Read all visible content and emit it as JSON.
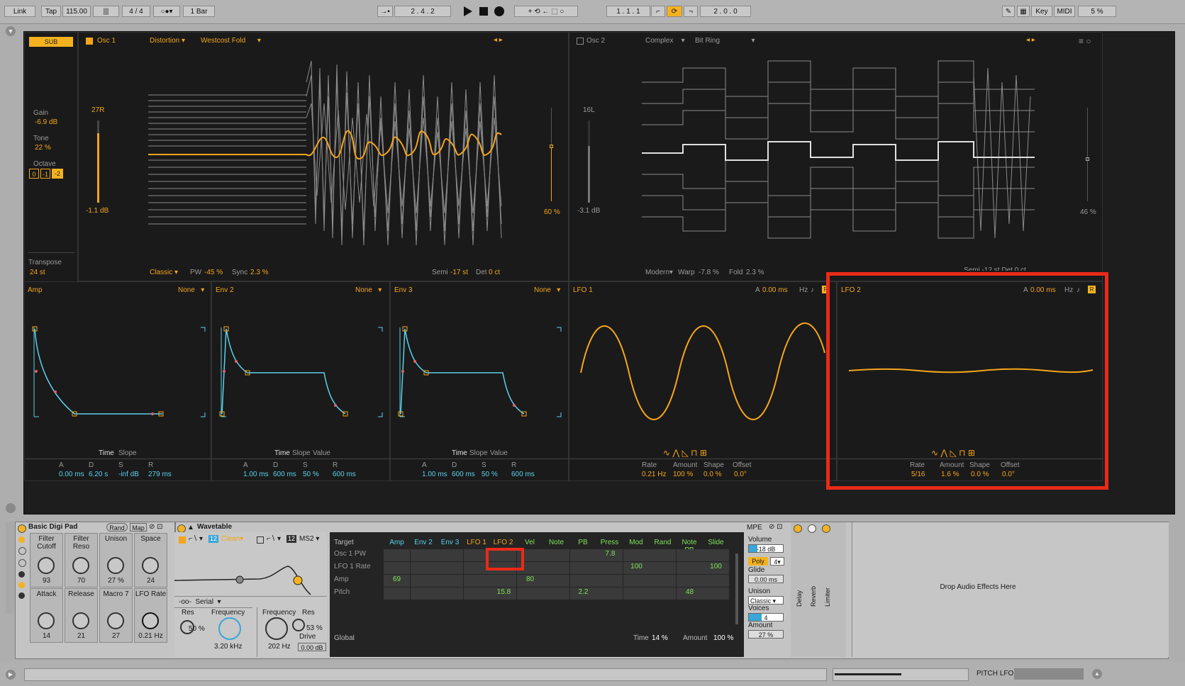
{
  "toolbar": {
    "link": "Link",
    "tap": "Tap",
    "tempo": "115.00",
    "signature": "4 / 4",
    "quantize": "1 Bar",
    "position": "2 . 4 . 2",
    "loop_start": "1 . 1 . 1",
    "loop_length": "2 . 0 . 0",
    "key": "Key",
    "midi": "MIDI",
    "cpu": "5 %"
  },
  "sub": {
    "badge": "SUB",
    "gain_label": "Gain",
    "gain": "-6.9 dB",
    "tone_label": "Tone",
    "tone": "22 %",
    "octave_label": "Octave",
    "octave_opts": [
      "0",
      "-1",
      "-2"
    ],
    "transpose_label": "Transpose",
    "transpose": "24 st"
  },
  "osc1": {
    "title": "Osc 1",
    "mode": "Distortion",
    "effect": "Westcost Fold",
    "pan": "27R",
    "level": "-1.1 dB",
    "mix": "60 %",
    "classic": "Classic",
    "pw_label": "PW",
    "pw": "-45 %",
    "sync_label": "Sync",
    "sync": "2.3 %",
    "semi_label": "Semi",
    "semi": "-17 st",
    "det_label": "Det",
    "det": "0 ct"
  },
  "osc2": {
    "title": "Osc 2",
    "mode": "Complex",
    "effect": "Bit Ring",
    "pan": "16L",
    "level": "-3.1 dB",
    "mix": "46 %",
    "modern": "Modern",
    "warp_label": "Warp",
    "warp": "-7.8 %",
    "fold_label": "Fold",
    "fold": "2.3 %",
    "semi_partial": "Semi -12 st Det 0 ct"
  },
  "envs": [
    {
      "title": "Amp",
      "none": "None",
      "tabs": [
        "Time",
        "Slope"
      ],
      "labels": [
        "A",
        "D",
        "S",
        "R"
      ],
      "values": [
        "0.00 ms",
        "6.20 s",
        "-inf dB",
        "279 ms"
      ]
    },
    {
      "title": "Env 2",
      "none": "None",
      "tabs": [
        "Time",
        "Slope",
        "Value"
      ],
      "labels": [
        "A",
        "D",
        "S",
        "R"
      ],
      "values": [
        "1.00 ms",
        "600 ms",
        "50 %",
        "600 ms"
      ]
    },
    {
      "title": "Env 3",
      "none": "None",
      "tabs": [
        "Time",
        "Slope",
        "Value"
      ],
      "labels": [
        "A",
        "D",
        "S",
        "R"
      ],
      "values": [
        "1.00 ms",
        "600 ms",
        "50 %",
        "600 ms"
      ]
    }
  ],
  "lfo1": {
    "title": "LFO 1",
    "a_label": "A",
    "a": "0.00 ms",
    "hz": "Hz",
    "r": "R",
    "labels": [
      "Rate",
      "Amount",
      "Shape",
      "Offset"
    ],
    "values": [
      "0.21 Hz",
      "100 %",
      "0.0 %",
      "0.0°"
    ]
  },
  "lfo2": {
    "title": "LFO 2",
    "a_label": "A",
    "a": "0.00 ms",
    "hz": "Hz",
    "r": "R",
    "labels": [
      "Rate",
      "Amount",
      "Shape",
      "Offset"
    ],
    "values": [
      "5/16",
      "1.6 %",
      "0.0 %",
      "0.0°"
    ]
  },
  "rack": {
    "name": "Basic Digi Pad",
    "rand": "Rand",
    "map": "Map",
    "macros": [
      {
        "label": "Filter Cutoff",
        "value": "93"
      },
      {
        "label": "Filter Reso",
        "value": "70"
      },
      {
        "label": "Unison",
        "value": "27 %"
      },
      {
        "label": "Space",
        "value": "24"
      },
      {
        "label": "Attack",
        "value": "14"
      },
      {
        "label": "Release",
        "value": "21"
      },
      {
        "label": "Macro 7",
        "value": "27"
      },
      {
        "label": "LFO Rate",
        "value": "0.21 Hz"
      }
    ]
  },
  "wavetable": {
    "title": "Wavetable",
    "filter1_slope": "12",
    "filter1_type": "Clean",
    "filter2_slope": "12",
    "filter2_type": "MS2",
    "routing": "Serial",
    "res_label": "Res",
    "res": "50 %",
    "freq_label": "Frequency",
    "freq": "3.20 kHz",
    "freq2_label": "Frequency",
    "freq2": "202 Hz",
    "res2_label": "Res",
    "res2": "53 %",
    "drive_label": "Drive",
    "drive": "0.00 dB"
  },
  "matrix": {
    "target_label": "Target",
    "columns": [
      "Amp",
      "Env 2",
      "Env 3",
      "LFO 1",
      "LFO 2",
      "Vel",
      "Note",
      "PB",
      "Press",
      "Mod",
      "Rand",
      "Note PB",
      "Slide"
    ],
    "rows": [
      "Osc 1 PW",
      "LFO 1 Rate",
      "Amp",
      "Pitch"
    ],
    "v_press": "7.8",
    "v_mod": "100",
    "v_slide": "100",
    "v_vel": "80",
    "v_amp": "69",
    "v_lfo2": "15.8",
    "v_pb": "2.2",
    "v_notepb": "48",
    "global": "Global",
    "time_label": "Time",
    "time": "14 %",
    "amount_label": "Amount",
    "amount": "100 %"
  },
  "voice": {
    "mpe": "MPE",
    "volume_label": "Volume",
    "volume": "-18 dB",
    "poly": "Poly",
    "poly_count": "4",
    "glide_label": "Glide",
    "glide": "0.00 ms",
    "unison_label": "Unison",
    "unison": "Classic",
    "voices_label": "Voices",
    "voices": "4",
    "amount_label": "Amount",
    "amount": "27 %"
  },
  "fx": [
    "Delay",
    "Reverb",
    "Limiter"
  ],
  "drop_text": "Drop Audio Effects Here",
  "status": {
    "clip": "PITCH LFO"
  }
}
